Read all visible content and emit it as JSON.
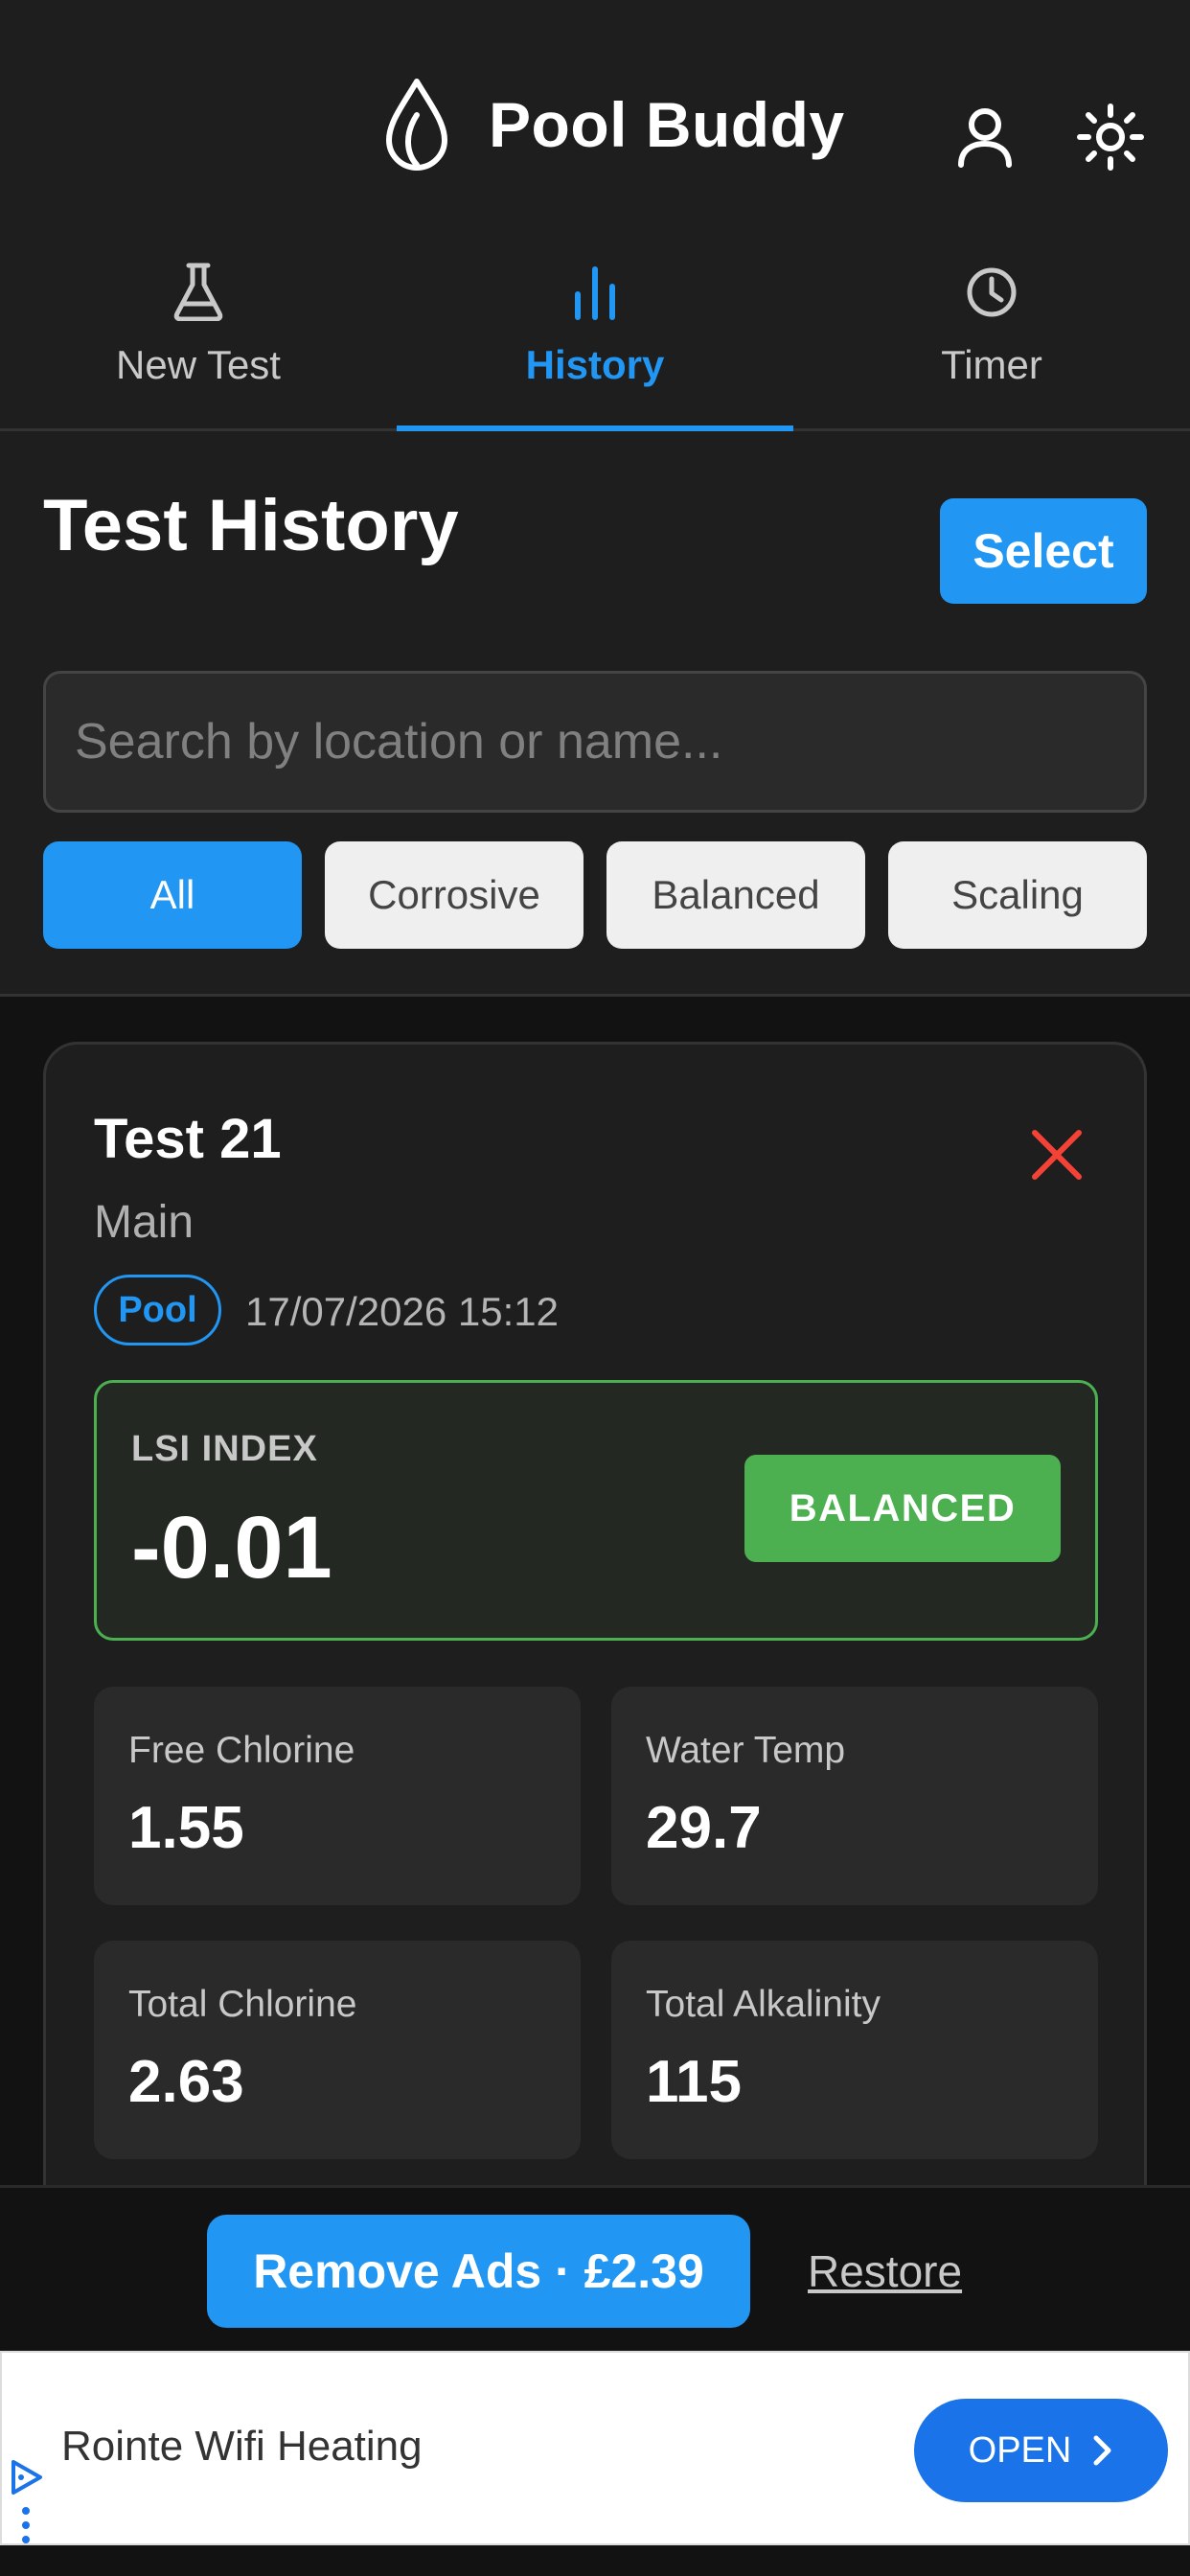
{
  "app": {
    "title": "Pool Buddy"
  },
  "header": {
    "icons": [
      "water-drop-icon",
      "user-icon",
      "sun-icon"
    ]
  },
  "tabs": [
    {
      "label": "New Test",
      "icon": "flask-icon",
      "active": false
    },
    {
      "label": "History",
      "icon": "bar-chart-icon",
      "active": true
    },
    {
      "label": "Timer",
      "icon": "clock-icon",
      "active": false
    }
  ],
  "toolbar": {
    "title": "Test History",
    "select_label": "Select"
  },
  "search": {
    "value": "",
    "placeholder": "Search by location or name..."
  },
  "filters": [
    {
      "label": "All",
      "active": true
    },
    {
      "label": "Corrosive",
      "active": false
    },
    {
      "label": "Balanced",
      "active": false
    },
    {
      "label": "Scaling",
      "active": false
    }
  ],
  "card": {
    "title": "Test 21",
    "location": "Main",
    "type_badge": "Pool",
    "datetime": "17/07/2026 15:12",
    "lsi": {
      "label": "LSI INDEX",
      "value": "-0.01",
      "status": "BALANCED"
    },
    "metrics": [
      {
        "label": "Free Chlorine",
        "value": "1.55"
      },
      {
        "label": "Water Temp",
        "value": "29.7"
      },
      {
        "label": "Total Chlorine",
        "value": "2.63"
      },
      {
        "label": "Total Alkalinity",
        "value": "115"
      }
    ]
  },
  "bottom": {
    "remove_ads_label": "Remove Ads · £2.39",
    "restore_label": "Restore"
  },
  "ad": {
    "text": "Rointe Wifi Heating",
    "open_label": "OPEN"
  },
  "colors": {
    "accent": "#2196f3",
    "balanced": "#4caf50",
    "danger": "#f44336",
    "background": "#121212",
    "surface": "#1e1e1e"
  }
}
